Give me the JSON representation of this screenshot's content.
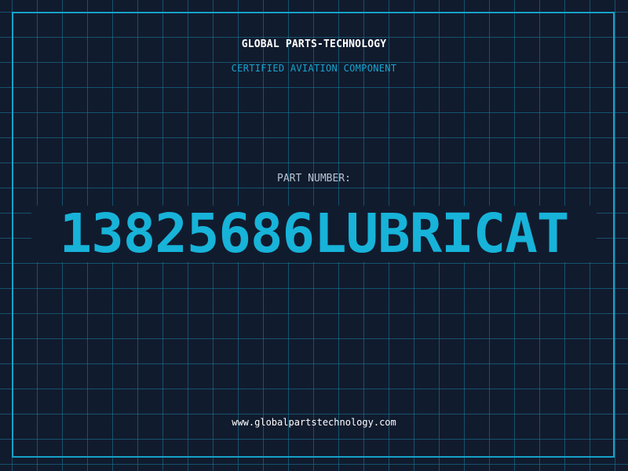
{
  "brand": {
    "name": "GLOBAL PARTS-TECHNOLOGY",
    "tagline": "CERTIFIED AVIATION COMPONENT"
  },
  "part": {
    "label": "PART NUMBER:",
    "number": "13825686LUBRICAT"
  },
  "footer": {
    "website": "www.globalpartstechnology.com"
  },
  "colors": {
    "background": "#111b2e",
    "grid": "#17809e",
    "frame": "#16a1c7",
    "accent": "#17b3d9",
    "brand_text": "#ffffff",
    "label_text": "#b9c4d2"
  }
}
